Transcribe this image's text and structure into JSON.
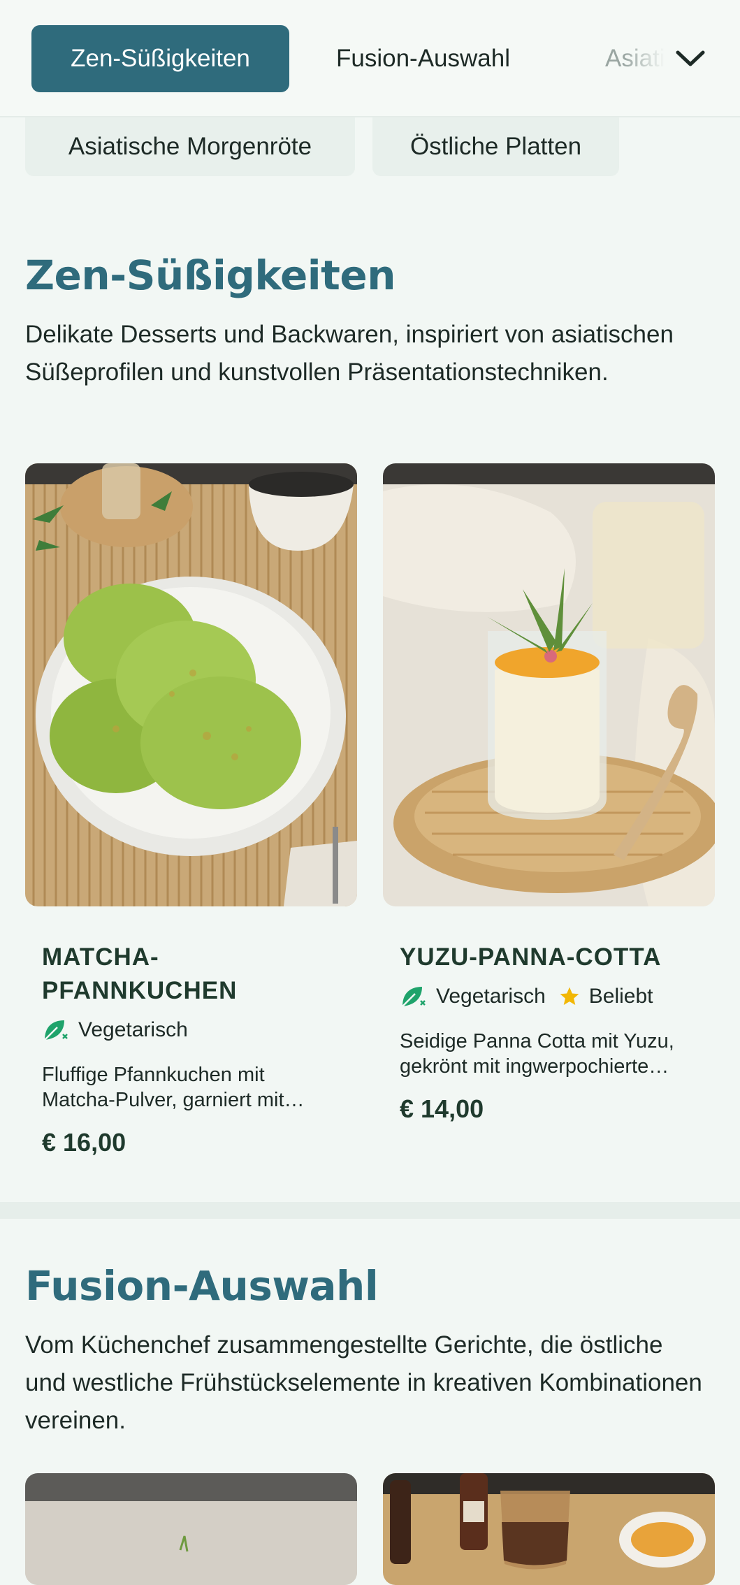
{
  "nav": {
    "tabs": [
      {
        "label": "Zen-Süßigkeiten",
        "active": true
      },
      {
        "label": "Fusion-Auswahl",
        "active": false
      },
      {
        "label": "Asiatische Morgenröte",
        "active": false
      }
    ],
    "expand_icon": "chevron-down-icon",
    "chips": [
      {
        "label": "Asiatische Morgenröte"
      },
      {
        "label": "Östliche Platten"
      }
    ]
  },
  "sections": [
    {
      "title": "Zen-Süßigkeiten",
      "description": "Delikate Desserts und Backwaren, inspiriert von asiatischen Süßeprofilen und kunstvollen Präsentationstechniken.",
      "items": [
        {
          "name": "MATCHA-PFANNKUCHEN",
          "tags": [
            {
              "label": "Vegetarisch",
              "icon": "vegetarian-icon"
            }
          ],
          "description": "Fluffige Pfannkuchen mit Matcha-Pulver, garniert mit…",
          "price": "€ 16,00"
        },
        {
          "name": "YUZU-PANNA-COTTA",
          "tags": [
            {
              "label": "Vegetarisch",
              "icon": "vegetarian-icon"
            },
            {
              "label": "Beliebt",
              "icon": "star-icon"
            }
          ],
          "description": "Seidige Panna Cotta mit Yuzu, gekrönt mit ingwerpochierte…",
          "price": "€ 14,00"
        }
      ]
    },
    {
      "title": "Fusion-Auswahl",
      "description": "Vom Küchenchef zusammengestellte Gerichte, die östliche und westliche Frühstückselemente in kreativen Kombinationen vereinen."
    }
  ],
  "colors": {
    "accent": "#2f6b7c",
    "background": "#f2f7f4",
    "vegetarian": "#1fa36b",
    "star": "#f2b705"
  }
}
